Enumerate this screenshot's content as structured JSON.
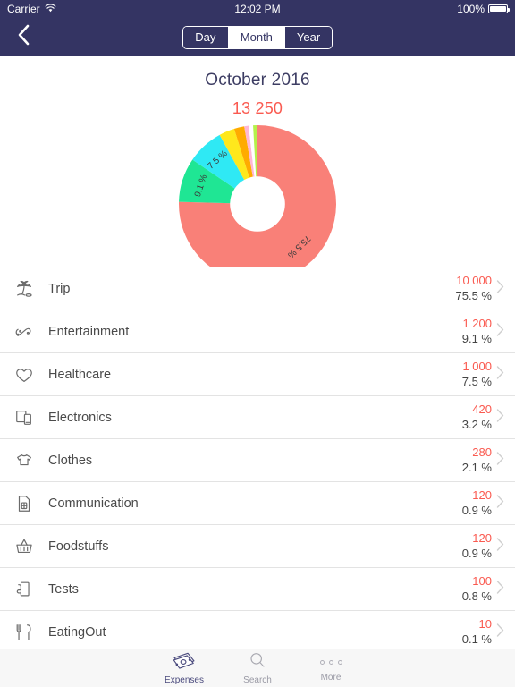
{
  "status_bar": {
    "carrier": "Carrier",
    "wifi_icon": "wifi-icon",
    "time": "12:02 PM",
    "battery_percent": "100%"
  },
  "nav": {
    "back_icon": "chevron-left-icon",
    "segments": [
      {
        "label": "Day",
        "active": false
      },
      {
        "label": "Month",
        "active": true
      },
      {
        "label": "Year",
        "active": false
      }
    ]
  },
  "header": {
    "month_title": "October 2016",
    "total": "13 250",
    "total_color": "#fa5a50",
    "title_color": "#3d3d63"
  },
  "chart_data": {
    "type": "pie",
    "title": "October 2016",
    "subtitle": "13 250",
    "donut": true,
    "inner_radius_ratio": 0.35,
    "start_angle_deg": -90,
    "categories": [
      "Trip",
      "Entertainment",
      "Healthcare",
      "Electronics",
      "Clothes",
      "Communication",
      "Foodstuffs",
      "Tests",
      "EatingOut"
    ],
    "values": [
      10000,
      1200,
      1000,
      420,
      280,
      120,
      120,
      100,
      10
    ],
    "percentages": [
      75.5,
      9.1,
      7.5,
      3.2,
      2.1,
      0.9,
      0.9,
      0.8,
      0.1
    ],
    "colors": [
      "#f98078",
      "#1fe694",
      "#2fe9f4",
      "#ffe81c",
      "#ffab00",
      "#ffb7d5",
      "#ffffff",
      "#b4f24a",
      "#f98078"
    ],
    "labels_shown": [
      "75.5 %",
      "9.1 %",
      "7.5 %"
    ],
    "label_color": "#3a3a3a",
    "legend": "none"
  },
  "list": {
    "rows": [
      {
        "icon": "palm-tree-icon",
        "label": "Trip",
        "amount": "10 000",
        "percent": "75.5 %"
      },
      {
        "icon": "gamepad-icon",
        "label": "Entertainment",
        "amount": "1 200",
        "percent": "9.1 %"
      },
      {
        "icon": "heart-icon",
        "label": "Healthcare",
        "amount": "1 000",
        "percent": "7.5 %"
      },
      {
        "icon": "devices-icon",
        "label": "Electronics",
        "amount": "420",
        "percent": "3.2 %"
      },
      {
        "icon": "tshirt-icon",
        "label": "Clothes",
        "amount": "280",
        "percent": "2.1 %"
      },
      {
        "icon": "sim-card-icon",
        "label": "Communication",
        "amount": "120",
        "percent": "0.9 %"
      },
      {
        "icon": "basket-icon",
        "label": "Foodstuffs",
        "amount": "120",
        "percent": "0.9 %"
      },
      {
        "icon": "flask-icon",
        "label": "Tests",
        "amount": "100",
        "percent": "0.8 %"
      },
      {
        "icon": "cutlery-icon",
        "label": "EatingOut",
        "amount": "10",
        "percent": "0.1 %"
      }
    ],
    "chevron_icon": "chevron-right-icon",
    "amount_color": "#fa5a50"
  },
  "tabbar": {
    "tabs": [
      {
        "label": "Expenses",
        "icon": "banknotes-icon",
        "active": true
      },
      {
        "label": "Search",
        "icon": "search-icon",
        "active": false
      },
      {
        "label": "More",
        "icon": "ellipsis-icon",
        "active": false
      }
    ]
  }
}
